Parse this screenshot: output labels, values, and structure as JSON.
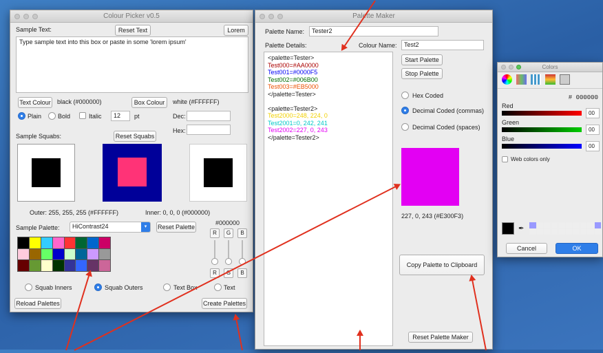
{
  "colour_picker": {
    "title": "Colour Picker v0.5",
    "sample_text_label": "Sample Text:",
    "reset_text": "Reset Text",
    "lorem": "Lorem",
    "sample_text_value": "Type sample text into this box or paste in some 'lorem ipsum'",
    "text_colour_btn": "Text Colour",
    "text_colour_value": "black (#000000)",
    "box_colour_btn": "Box Colour",
    "box_colour_value": "white (#FFFFFF)",
    "plain": "Plain",
    "bold": "Bold",
    "italic": "Italic",
    "font_size": "12",
    "pt": "pt",
    "dec_label": "Dec:",
    "hex_label": "Hex:",
    "sample_squabs_label": "Sample Squabs:",
    "reset_squabs": "Reset Squabs",
    "outer_inner_text": "Outer: 255, 255, 255 (#FFFFFF)",
    "inner_text": "Inner: 0, 0, 0 (#000000)",
    "sample_palette_label": "Sample Palette:",
    "palette_select": "HiContrast24",
    "reset_palette": "Reset Palette",
    "hex_readout": "#000000",
    "r": "R",
    "g": "G",
    "b": "B",
    "squab_inners": "Squab Inners",
    "squab_outers": "Squab Outers",
    "text_box": "Text Box",
    "text": "Text",
    "reload_palettes": "Reload Palettes",
    "create_palettes": "Create Palettes",
    "palette_swatches": [
      "#000000",
      "#ffff00",
      "#33ccff",
      "#ff66cc",
      "#ff3333",
      "#006633",
      "#0066cc",
      "#cc0066",
      "#ffccdd",
      "#996600",
      "#66ff66",
      "#0000cc",
      "#ccffcc",
      "#006699",
      "#cc99ff",
      "#999999",
      "#660000",
      "#669933",
      "#ffffcc",
      "#003300",
      "#333399",
      "#3366ff",
      "#663366",
      "#cc6699"
    ],
    "colors": {
      "squab1_outer": "#ffffff",
      "squab1_inner": "#000000",
      "squab2_outer": "#000099",
      "squab2_inner": "#ff3377",
      "squab3_outer": "#ffffff",
      "squab3_inner": "#000000"
    }
  },
  "palette_maker": {
    "title": "Palette Maker",
    "palette_name_label": "Palette Name:",
    "palette_name_value": "Tester2",
    "palette_details_label": "Palette Details:",
    "colour_name_label": "Colour Name:",
    "colour_name_value": "Test2",
    "details_lines": [
      {
        "text": "<palette=Tester>",
        "color": "#222222"
      },
      {
        "text": "Test000=#AA0000",
        "color": "#aa0000"
      },
      {
        "text": "Test001=#0000F5",
        "color": "#0000f5"
      },
      {
        "text": "Test002=#006B00",
        "color": "#006b00"
      },
      {
        "text": "Test003=#EB5000",
        "color": "#eb5000"
      },
      {
        "text": "</palette=Tester>",
        "color": "#222222"
      },
      {
        "text": "",
        "color": "#222222"
      },
      {
        "text": "<palette=Tester2>",
        "color": "#222222"
      },
      {
        "text": "Test2000=248, 224, 0",
        "color": "#f0d000"
      },
      {
        "text": "Test2001=0, 242, 241",
        "color": "#00c8c8"
      },
      {
        "text": "Test2002=227, 0, 243",
        "color": "#e300f3"
      },
      {
        "text": "</palette=Tester2>",
        "color": "#222222"
      }
    ],
    "start_palette": "Start Palette",
    "stop_palette": "Stop Palette",
    "hex_coded": "Hex Coded",
    "decimal_commas": "Decimal Coded (commas)",
    "decimal_spaces": "Decimal Coded (spaces)",
    "swatch_color": "#e300f3",
    "swatch_text": "227, 0, 243 (#E300F3)",
    "copy_palette": "Copy Palette to Clipboard",
    "reset_maker": "Reset Palette Maker"
  },
  "colors_panel": {
    "title": "Colors",
    "hex_value": "# 000000",
    "red": "Red",
    "green": "Green",
    "blue": "Blue",
    "red_val": "00",
    "green_val": "00",
    "blue_val": "00",
    "web_colors": "Web colors only",
    "cancel": "Cancel",
    "ok": "OK"
  }
}
